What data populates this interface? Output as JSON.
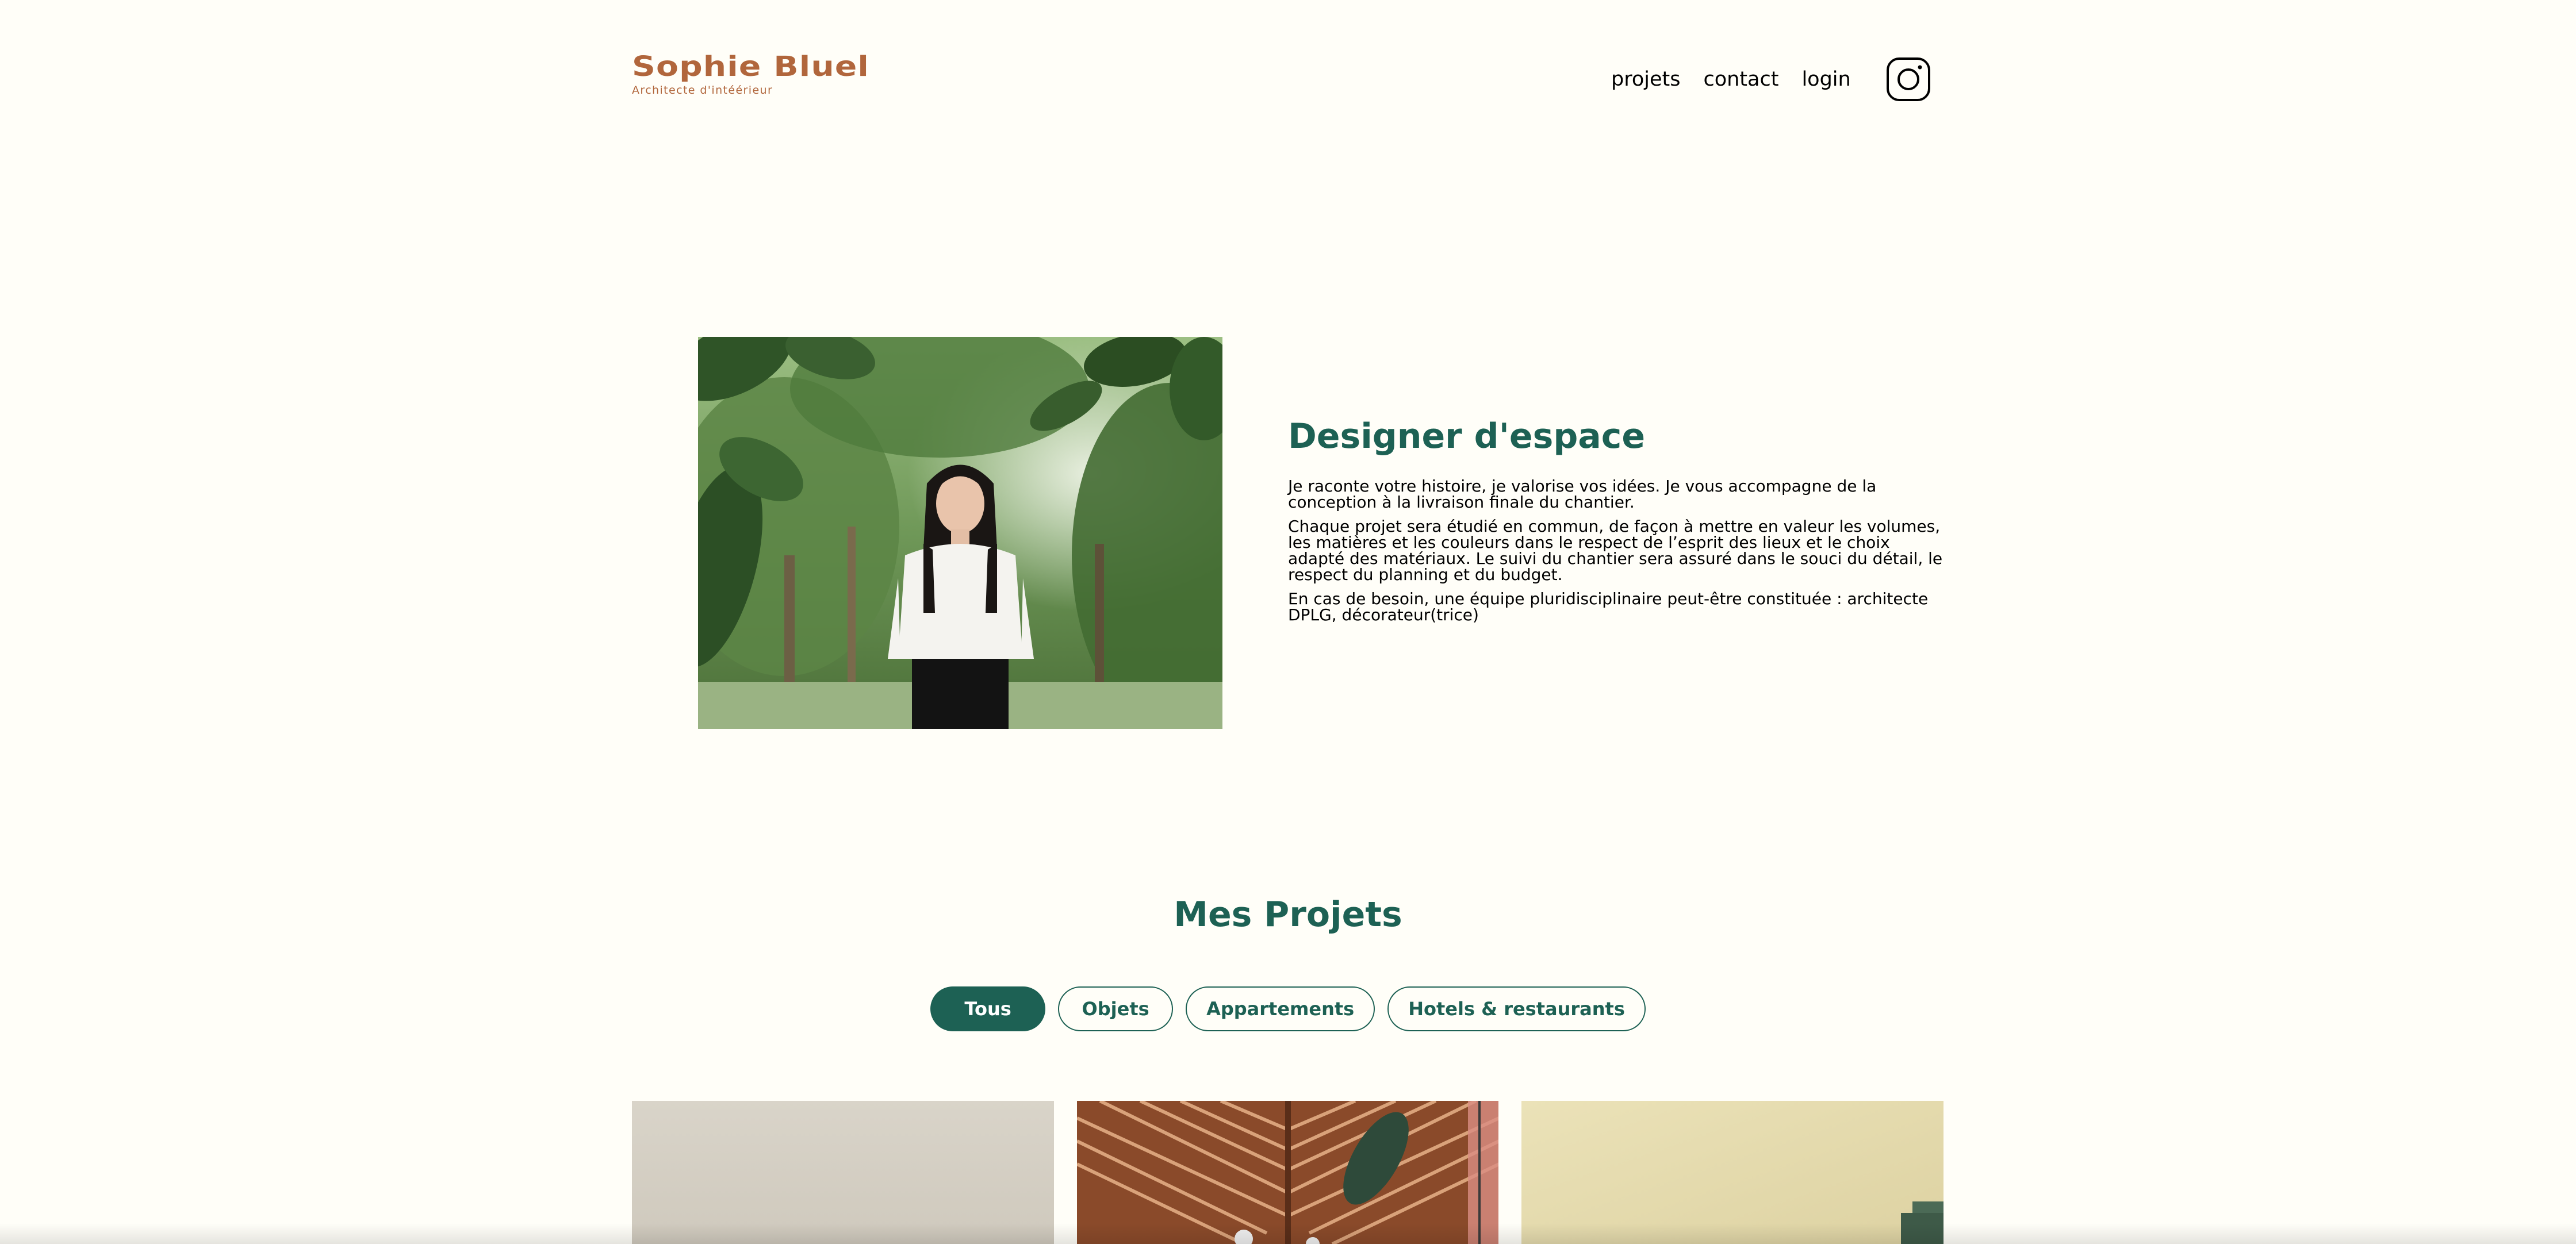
{
  "header": {
    "logo_title": "Sophie Bluel",
    "logo_subtitle": "Architecte d'intéérieur",
    "nav": [
      {
        "label": "projets"
      },
      {
        "label": "contact"
      },
      {
        "label": "login"
      }
    ],
    "social_icon": "instagram-icon"
  },
  "intro": {
    "heading": "Designer d'espace",
    "paragraphs": [
      "Je raconte votre histoire, je valorise vos idées. Je vous accompagne de la conception à la livraison finale du chantier.",
      "Chaque projet sera étudié en commun, de façon à mettre en valeur les volumes, les matières et les couleurs dans le respect de l’esprit des lieux et le choix adapté des matériaux. Le suivi du chantier sera assuré dans le souci du détail, le respect du planning et du budget.",
      "En cas de besoin, une équipe pluridisciplinaire peut-être constituée : architecte DPLG, décorateur(trice)"
    ]
  },
  "projects": {
    "heading": "Mes Projets",
    "filters": [
      {
        "label": "Tous",
        "active": true
      },
      {
        "label": "Objets",
        "active": false
      },
      {
        "label": "Appartements",
        "active": false
      },
      {
        "label": "Hotels & restaurants",
        "active": false
      }
    ]
  },
  "colors": {
    "background": "#fffef8",
    "brand": "#b1663c",
    "accent": "#1d6154"
  }
}
